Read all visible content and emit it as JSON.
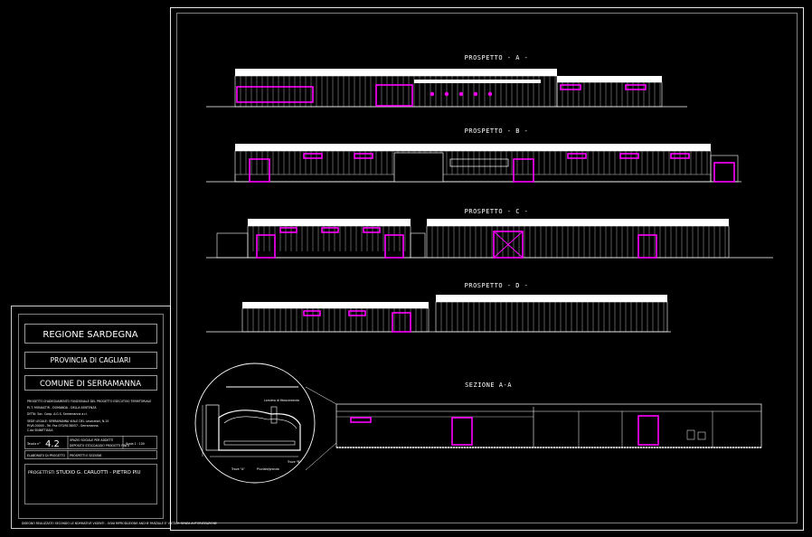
{
  "drawing": {
    "elevations": [
      {
        "id": "a",
        "title": "PROSPETTO - A -"
      },
      {
        "id": "b",
        "title": "PROSPETTO - B -"
      },
      {
        "id": "c",
        "title": "PROSPETTO - C -"
      },
      {
        "id": "d",
        "title": "PROSPETTO - D -"
      }
    ],
    "section_title": "SEZIONE A-A",
    "detail_labels": [
      "Lamiera di fibrocemento",
      "Trave \"A\"",
      "Trave \"B\"",
      "Pluviale/gronda"
    ]
  },
  "title_block": {
    "region": "REGIONE SARDEGNA",
    "province": "PROVINCIA DI CAGLIARI",
    "municipality": "COMUNE DI SERRAMANNA",
    "project_lines": [
      "PROGETTO D'ADEGUAMENTO FUNZIONALE DEL PROGETTO ESECUTIVO TERRITORIALE",
      "P.I.T. MONASTIR - DOMANDA - DELLA SENTENZA",
      "DITTA: Soc. Coop. A.G.S. Serramanna a.r.l.",
      "SEDE LEGALE: SERRAMANNA VIALE DEL Lavoratori, N.15",
      "P.IVA 00000 - Tel. Fax 070/9138057 - Serramanna",
      "C.da SINNITTIAGA"
    ],
    "table_no_label": "Tavola n°",
    "table_no": "4.2",
    "subject_lines": [
      "SPAZIO SOCIALE PER ADDETTI",
      "DEPOSITO STOCCAGGIO PRODOTTI FINITI"
    ],
    "scale": "Scala 1 : 100",
    "drawing_type_label": "ELABORATO DI PROGETTO",
    "drawing_type": "PROSPETTI E SEZIONE",
    "designer_label": "PROGETTISTI",
    "designer": "STUDIO G. CARLOTTI - PIETRO PIU",
    "footer_note": "DISEGNO REALIZZATO SECONDO LE NORMATIVE VIGENTI - OGNI RIPRODUZIONE ANCHE PARZIALE E' VIETATA SENZA AUTORIZZAZIONE"
  },
  "colors": {
    "background": "#000000",
    "line": "#ffffff",
    "accent": "#ff00ff"
  }
}
